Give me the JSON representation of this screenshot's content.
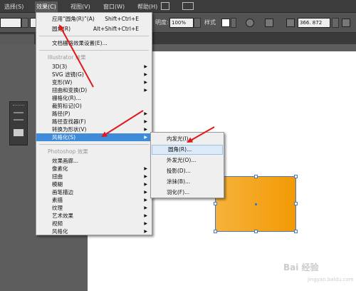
{
  "menubar": {
    "items": [
      "选择(S)",
      "效果(C)",
      "视图(V)",
      "窗口(W)",
      "帮助(H)"
    ]
  },
  "toolbar": {
    "opacity_label": "明度:",
    "opacity_value": "100%",
    "style_label": "样式",
    "x_value": "366. 872"
  },
  "effect_menu": {
    "items": [
      {
        "label": "应用“圆角(R)”(A)",
        "shortcut": "Shift+Ctrl+E"
      },
      {
        "label": "圆角(R)",
        "shortcut": "Alt+Shift+Ctrl+E"
      },
      {
        "label": "文档栅格效果设置(E)..."
      }
    ],
    "illustrator_header": "Illustrator 效果",
    "illustrator_items": [
      {
        "label": "3D(3)"
      },
      {
        "label": "SVG 滤镜(G)"
      },
      {
        "label": "变形(W)"
      },
      {
        "label": "扭曲和变换(D)"
      },
      {
        "label": "栅格化(R)..."
      },
      {
        "label": "裁剪标记(O)"
      },
      {
        "label": "路径(P)"
      },
      {
        "label": "路径查找器(F)"
      },
      {
        "label": "转换为形状(V)"
      },
      {
        "label": "风格化(S)"
      }
    ],
    "photoshop_header": "Photoshop 效果",
    "photoshop_items": [
      {
        "label": "效果画廊..."
      },
      {
        "label": "像素化"
      },
      {
        "label": "扭曲"
      },
      {
        "label": "模糊"
      },
      {
        "label": "画笔描边"
      },
      {
        "label": "素描"
      },
      {
        "label": "纹理"
      },
      {
        "label": "艺术效果"
      },
      {
        "label": "视频"
      },
      {
        "label": "风格化"
      }
    ]
  },
  "stylize_submenu": {
    "items": [
      "内发光(I)...",
      "圆角(R)...",
      "外发光(O)...",
      "投影(D)...",
      "涂抹(B)...",
      "羽化(F)..."
    ]
  },
  "artwork": {
    "gradient_start": "#f7b23a",
    "gradient_end": "#f29a05",
    "selection_color": "#4a78c0"
  },
  "annotation_color": "#e0191e",
  "watermark": {
    "text": "Bai 经验",
    "sub": "jingyan.baidu.com"
  }
}
